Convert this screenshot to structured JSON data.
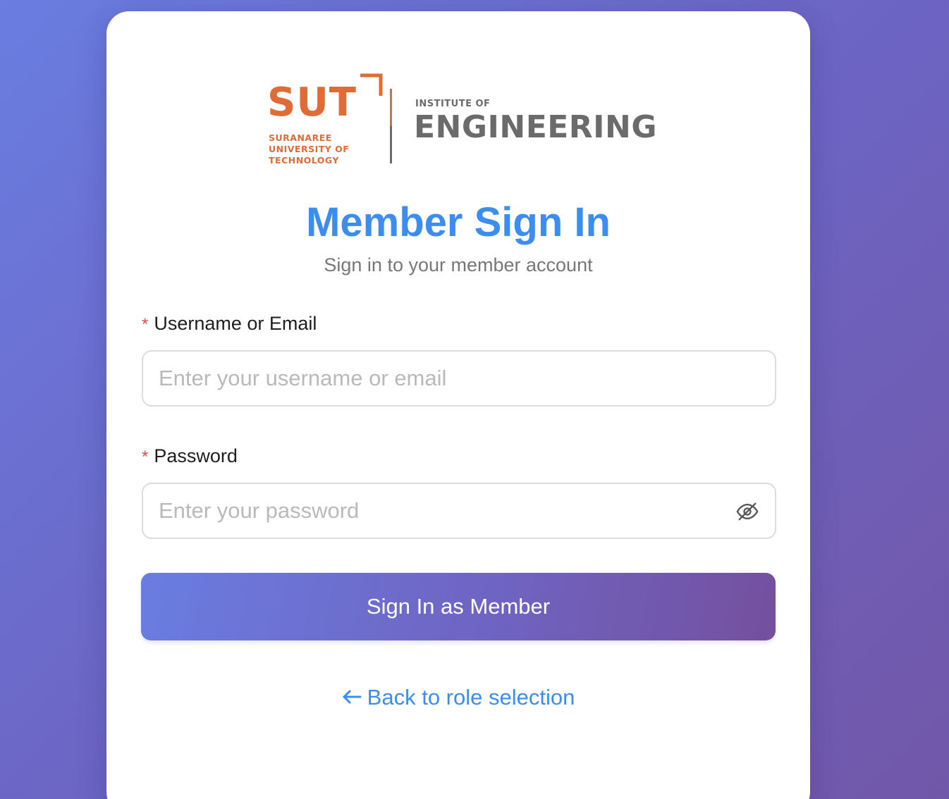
{
  "logo": {
    "mark": "SUT",
    "university_lines": [
      "SURANAREE",
      "UNIVERSITY OF",
      "TECHNOLOGY"
    ],
    "institute": "INSTITUTE OF",
    "faculty": "ENGINEERING",
    "brand_orange": "#e06b35",
    "brand_gray": "#6b6b6b"
  },
  "heading": {
    "title": "Member Sign In",
    "subtitle": "Sign in to your member account"
  },
  "form": {
    "username": {
      "required_mark": "*",
      "label": "Username or Email",
      "placeholder": "Enter your username or email",
      "value": ""
    },
    "password": {
      "required_mark": "*",
      "label": "Password",
      "placeholder": "Enter your password",
      "value": "",
      "toggle_icon": "eye-off-icon"
    },
    "submit_label": "Sign In as Member"
  },
  "back_link": {
    "icon": "arrow-left-icon",
    "label": "Back to role selection"
  },
  "colors": {
    "accent": "#3b8df0",
    "required": "#e24b4b",
    "gradient_start": "#6a7de0",
    "gradient_end": "#74509e"
  }
}
